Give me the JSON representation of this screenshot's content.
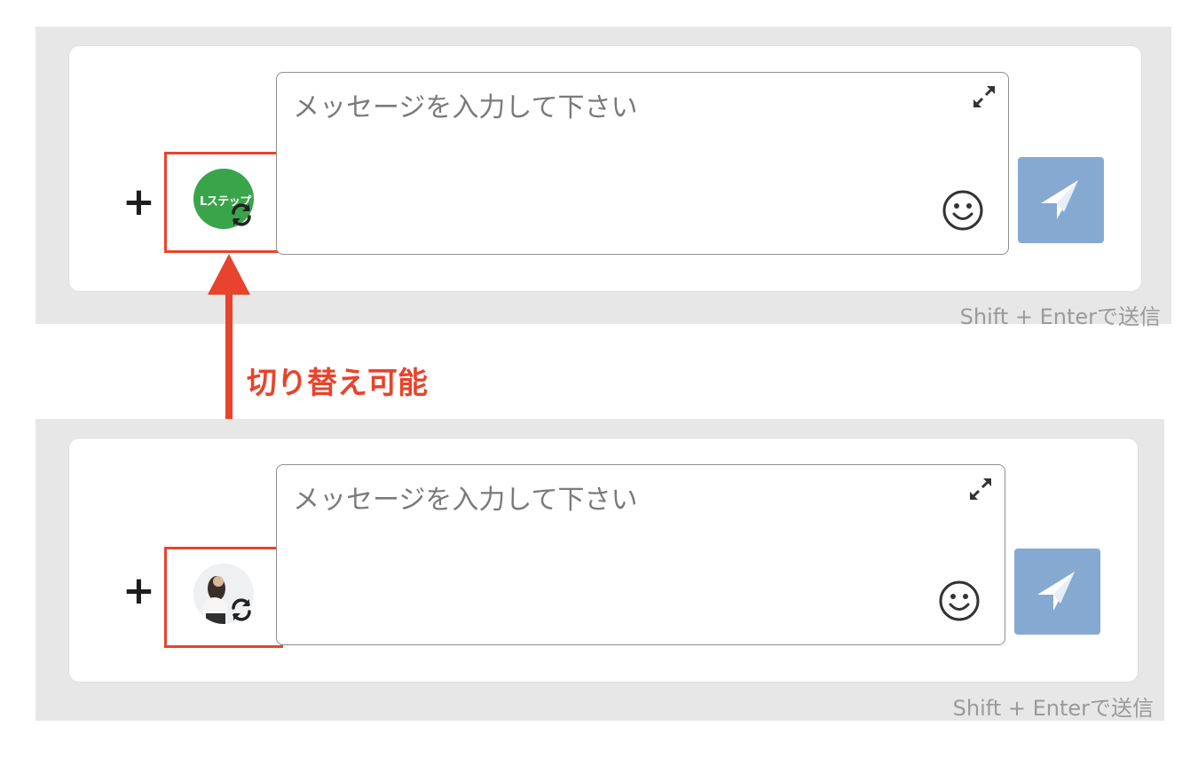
{
  "composer_top": {
    "placeholder": "メッセージを入力して下さい",
    "hint": "Shift + Enterで送信",
    "avatar_logo_text": "Lステップ"
  },
  "composer_bottom": {
    "placeholder": "メッセージを入力して下さい",
    "hint": "Shift + Enterで送信"
  },
  "annotation": {
    "label": "切り替え可能"
  },
  "colors": {
    "highlight": "#e8432c",
    "send_button": "#86a9d2",
    "brand_green": "#3aa44a",
    "panel_bg": "#e7e7e7"
  },
  "icons": {
    "add": "plus-icon",
    "switch": "refresh-icon",
    "expand": "expand-icon",
    "emoji": "smiley-icon",
    "send": "paper-plane-icon"
  }
}
